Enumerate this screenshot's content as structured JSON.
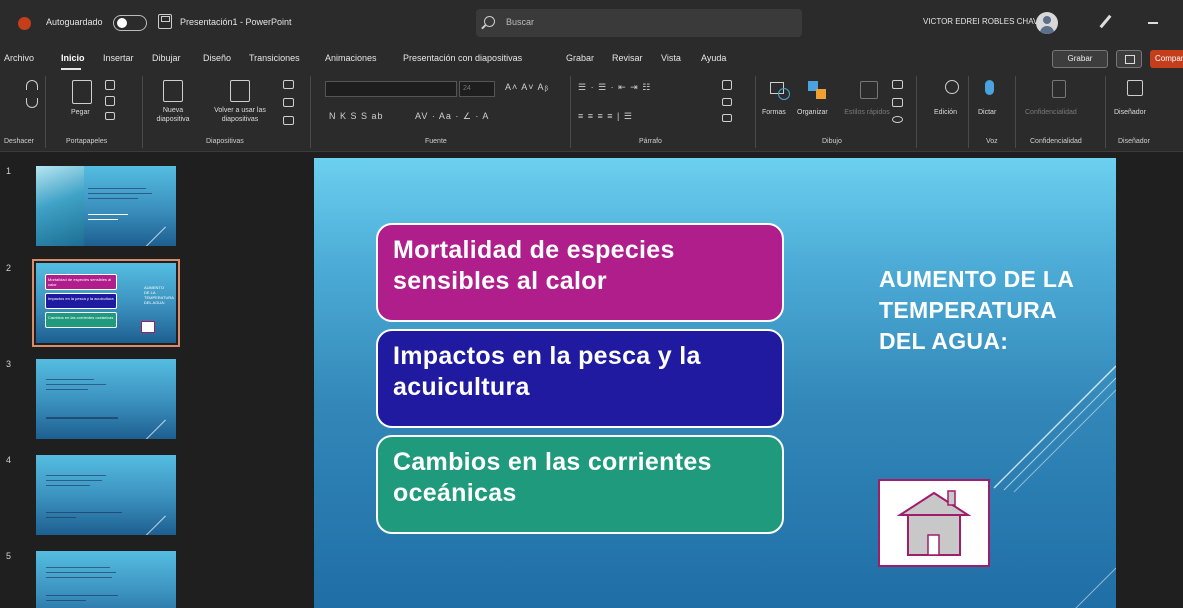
{
  "titlebar": {
    "autosave_label": "Autoguardado",
    "autosave_state": "Desactivado",
    "document_title": "Presentación1  -  PowerPoint",
    "search_placeholder": "Buscar",
    "user_name": "VICTOR EDREI ROBLES CHAVEZ"
  },
  "menu": {
    "items": [
      "Archivo",
      "Inicio",
      "Insertar",
      "Dibujar",
      "Diseño",
      "Transiciones",
      "Animaciones",
      "Presentación con diapositivas",
      "Grabar",
      "Revisar",
      "Vista",
      "Ayuda"
    ],
    "active": "Inicio",
    "record_label": "Grabar",
    "share_label": "Compartir"
  },
  "ribbon": {
    "undo_group": "Deshacer",
    "clipboard_group": "Portapapeles",
    "paste_label": "Pegar",
    "slides_group": "Diapositivas",
    "new_slide_label": "Nueva diapositiva",
    "reuse_slides_label": "Volver a usar las diapositivas",
    "font_group": "Fuente",
    "font_size": "24",
    "format_buttons": "N  K  S  S  ab",
    "paragraph_group": "Párrafo",
    "drawing_group": "Dibujo",
    "shapes_label": "Formas",
    "arrange_label": "Organizar",
    "quick_styles_label": "Estilos rápidos",
    "editing_label": "Edición",
    "dictate_label": "Dictar",
    "voice_group": "Voz",
    "sensitivity_label": "Confidencialidad",
    "sensitivity_group": "Confidencialidad",
    "designer_label": "Diseñador",
    "designer_group": "Diseñador"
  },
  "thumbnails": {
    "numbers": [
      "1",
      "2",
      "3",
      "4",
      "5"
    ],
    "selected": 2
  },
  "slide": {
    "box1_text": "Mortalidad de especies sensibles al calor",
    "box2_text": "Impactos en la pesca y la acuicultura",
    "box3_text": "Cambios en las corrientes oceánicas",
    "title": "AUMENTO DE LA TEMPERATURA DEL AGUA:",
    "colors": {
      "box1": "#b01e8c",
      "box2": "#1f1aa0",
      "box3": "#1f9a7c",
      "house_border": "#a01d6b"
    },
    "icon": "house-icon"
  }
}
